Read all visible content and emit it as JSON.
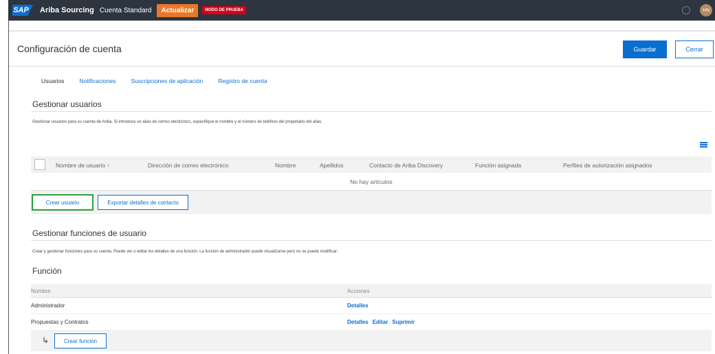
{
  "topbar": {
    "logo": "SAP",
    "app_name": "Ariba Sourcing",
    "account_type": "Cuenta Standard",
    "upgrade_label": "Actualizar",
    "test_mode_badge": "MODO DE PRUEBA",
    "avatar_initials": "HN",
    "colors": {
      "bar": "#2d3540",
      "upgrade": "#e8792b",
      "badge": "#d0021b"
    }
  },
  "header": {
    "title": "Configuración de cuenta",
    "save_label": "Guardar",
    "close_label": "Cerrar",
    "accent": "#0a6ed1"
  },
  "tabs": [
    {
      "label": "Usuarios",
      "active": true
    },
    {
      "label": "Notificaciones",
      "active": false
    },
    {
      "label": "Suscripciones de aplicación",
      "active": false
    },
    {
      "label": "Registro de cuenta",
      "active": false
    }
  ],
  "users": {
    "title": "Gestionar usuarios",
    "description": "Gestionar usuarios para su cuenta de Ariba. Si introduce un alias de correo electrónico, especifique el nombre y el número de teléfono del propietario del alias.",
    "columns": [
      "Nombre de usuario ↑",
      "Dirección de correo electrónico",
      "Nombre",
      "Apellidos",
      "Contacto de Ariba Discovery",
      "Función asignada",
      "Perfiles de autorización asignados"
    ],
    "empty_text": "No hay artículos",
    "create_user_label": "Crear usuario",
    "export_label": "Exportar detalles de contacto"
  },
  "roles": {
    "title": "Gestionar funciones de usuario",
    "description": "Crear y gestionar funciones para su cuenta. Puede ver o editar los detalles de una función. La función de administrador puede visualizarse pero no se puede modificar.",
    "subtitle": "Función",
    "col_name": "Nombre",
    "col_actions": "Acciones",
    "rows": [
      {
        "name": "Administrador",
        "actions": [
          "Detalles"
        ]
      },
      {
        "name": "Propuestas y Contratos",
        "actions": [
          "Detalles",
          "Editar",
          "Suprimir"
        ]
      }
    ],
    "create_label": "Crear función"
  }
}
